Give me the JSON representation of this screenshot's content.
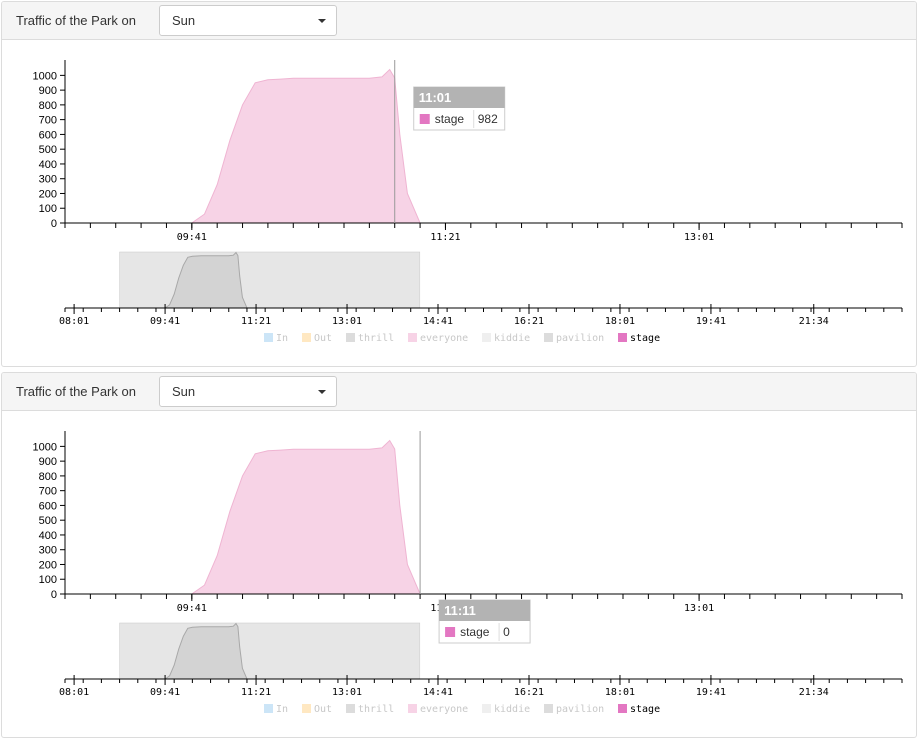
{
  "panels": [
    {
      "title": "Traffic of the Park on",
      "day_select": {
        "value": "Sun"
      },
      "tooltip": {
        "time": "11:01",
        "series": "stage",
        "value": "982"
      }
    },
    {
      "title": "Traffic of the Park on",
      "day_select": {
        "value": "Sun"
      },
      "tooltip": {
        "time": "11:11",
        "series": "stage",
        "value": "0"
      }
    }
  ],
  "colors": {
    "stage_fill": "#f7d3e6",
    "stage_stroke": "#efb4d2",
    "stage_legend": "#e377c2",
    "context_fill": "#d3d3d3",
    "brush": "#e6e6e6",
    "tooltip_header": "#b3b3b3"
  },
  "chart_data": [
    {
      "type": "area",
      "title": "",
      "focus": {
        "x_ticks": [
          "09:41",
          "11:21",
          "13:01"
        ],
        "xlim": [
          "08:51",
          "14:21"
        ],
        "y_ticks": [
          0,
          100,
          200,
          300,
          400,
          500,
          600,
          700,
          800,
          900,
          1000
        ],
        "ylim": [
          0,
          1050
        ]
      },
      "context": {
        "x_ticks": [
          "08:01",
          "09:41",
          "11:21",
          "13:01",
          "14:41",
          "16:21",
          "18:01",
          "19:41",
          "21:34"
        ],
        "xlim": [
          "07:51",
          "23:11"
        ],
        "brush": [
          "08:51",
          "14:21"
        ]
      },
      "legend": [
        {
          "name": "In",
          "color": "#cce5f7",
          "active": false
        },
        {
          "name": "Out",
          "color": "#ffe8c2",
          "active": false
        },
        {
          "name": "thrill",
          "color": "#dcdcdc",
          "active": false
        },
        {
          "name": "everyone",
          "color": "#f7d3e6",
          "active": false
        },
        {
          "name": "kiddie",
          "color": "#efefef",
          "active": false
        },
        {
          "name": "pavilion",
          "color": "#dcdcdc",
          "active": false
        },
        {
          "name": "stage",
          "color": "#e377c2",
          "active": true
        }
      ],
      "series": [
        {
          "name": "stage",
          "x": [
            "09:41",
            "09:46",
            "09:51",
            "09:56",
            "10:01",
            "10:06",
            "10:11",
            "10:16",
            "10:21",
            "10:31",
            "10:41",
            "10:51",
            "10:56",
            "10:59",
            "11:01",
            "11:03",
            "11:06",
            "11:11"
          ],
          "values": [
            0,
            60,
            260,
            560,
            800,
            950,
            970,
            975,
            980,
            980,
            980,
            980,
            990,
            1040,
            982,
            600,
            200,
            0
          ]
        }
      ],
      "tooltip_at": "11:01"
    },
    {
      "type": "area",
      "title": "",
      "focus": {
        "x_ticks": [
          "09:41",
          "11:21",
          "13:01"
        ],
        "xlim": [
          "08:51",
          "14:21"
        ],
        "y_ticks": [
          0,
          100,
          200,
          300,
          400,
          500,
          600,
          700,
          800,
          900,
          1000
        ],
        "ylim": [
          0,
          1050
        ]
      },
      "context": {
        "x_ticks": [
          "08:01",
          "09:41",
          "11:21",
          "13:01",
          "14:41",
          "16:21",
          "18:01",
          "19:41",
          "21:34"
        ],
        "xlim": [
          "07:51",
          "23:11"
        ],
        "brush": [
          "08:51",
          "14:21"
        ]
      },
      "legend": [
        {
          "name": "In",
          "color": "#cce5f7",
          "active": false
        },
        {
          "name": "Out",
          "color": "#ffe8c2",
          "active": false
        },
        {
          "name": "thrill",
          "color": "#dcdcdc",
          "active": false
        },
        {
          "name": "everyone",
          "color": "#f7d3e6",
          "active": false
        },
        {
          "name": "kiddie",
          "color": "#efefef",
          "active": false
        },
        {
          "name": "pavilion",
          "color": "#dcdcdc",
          "active": false
        },
        {
          "name": "stage",
          "color": "#e377c2",
          "active": true
        }
      ],
      "series": [
        {
          "name": "stage",
          "x": [
            "09:41",
            "09:46",
            "09:51",
            "09:56",
            "10:01",
            "10:06",
            "10:11",
            "10:16",
            "10:21",
            "10:31",
            "10:41",
            "10:51",
            "10:56",
            "10:59",
            "11:01",
            "11:03",
            "11:06",
            "11:11"
          ],
          "values": [
            0,
            60,
            260,
            560,
            800,
            950,
            970,
            975,
            980,
            980,
            980,
            980,
            990,
            1040,
            982,
            600,
            200,
            0
          ]
        }
      ],
      "tooltip_at": "11:11"
    }
  ]
}
